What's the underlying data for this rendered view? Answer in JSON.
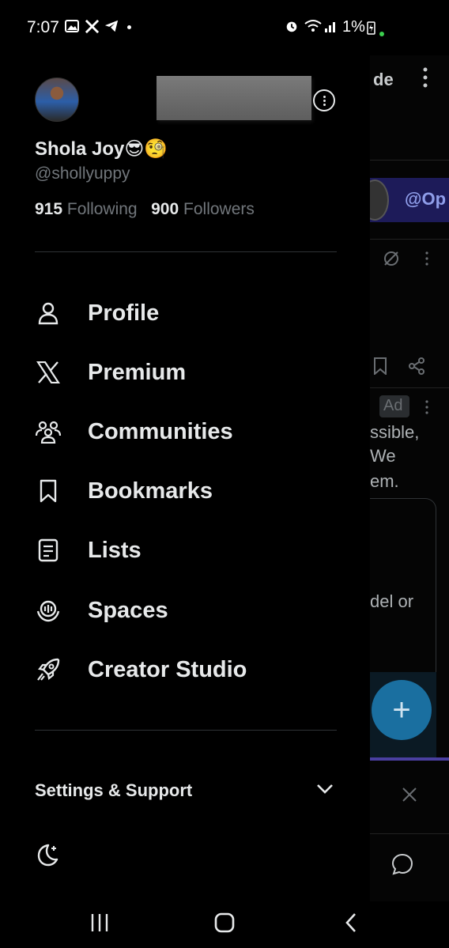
{
  "status_bar": {
    "time": "7:07",
    "battery": "1%",
    "icons": [
      "gallery-icon",
      "x-icon",
      "telegram-icon",
      "alarm-icon",
      "wifi-icon",
      "signal-icon",
      "battery-charging-icon"
    ]
  },
  "profile": {
    "name": "Shola Joy",
    "emoji": "😎🧐",
    "handle": "@shollyuppy",
    "following_count": "915",
    "following_label": "Following",
    "followers_count": "900",
    "followers_label": "Followers"
  },
  "menu": [
    {
      "label": "Profile",
      "icon": "person-icon"
    },
    {
      "label": "Premium",
      "icon": "x-logo-icon"
    },
    {
      "label": "Communities",
      "icon": "communities-icon"
    },
    {
      "label": "Bookmarks",
      "icon": "bookmark-icon"
    },
    {
      "label": "Lists",
      "icon": "list-icon"
    },
    {
      "label": "Spaces",
      "icon": "spaces-icon"
    },
    {
      "label": "Creator Studio",
      "icon": "rocket-icon"
    }
  ],
  "settings": {
    "label": "Settings & Support"
  },
  "background": {
    "header_fragment": "de",
    "banner_fragment": "@Op",
    "ad_label": "Ad",
    "text_line_1": "ssible,",
    "text_line_2": "We",
    "text_line_3": "em.",
    "text_line_4": "del or",
    "fab_label": "+"
  },
  "colors": {
    "background": "#000000",
    "text_primary": "#e7e9ea",
    "text_secondary": "#71767b",
    "divider": "#2f3336",
    "fab": "#1a6fa0"
  }
}
